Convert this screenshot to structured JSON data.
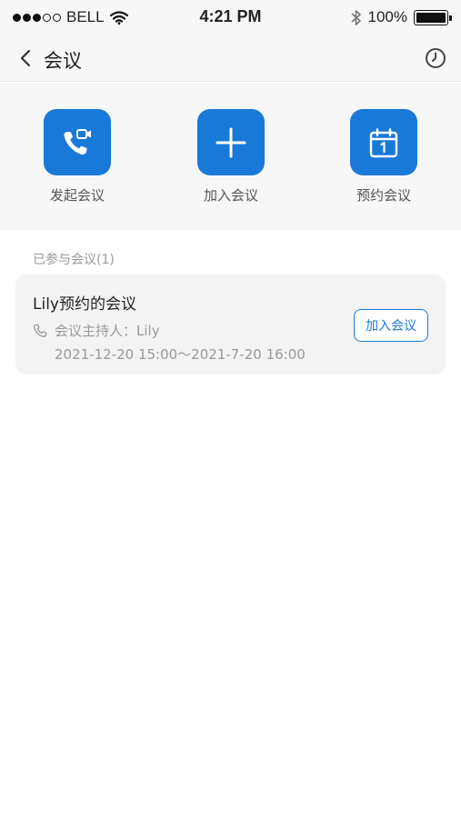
{
  "status_bar": {
    "carrier": "BELL",
    "time": "4:21 PM",
    "battery": "100%",
    "battery_level": 1.0,
    "signal_bars_filled": 3,
    "signal_bars_total": 5
  },
  "nav": {
    "title": "会议",
    "back_icon": "chevron-left-icon",
    "history_icon": "clock-icon"
  },
  "actions": [
    {
      "label": "发起会议",
      "icon": "video-call-icon"
    },
    {
      "label": "加入会议",
      "icon": "plus-icon"
    },
    {
      "label": "预约会议",
      "icon": "calendar-icon"
    }
  ],
  "section": {
    "label": "已参与会议(1)"
  },
  "meetings": [
    {
      "title": "Lily预约的会议",
      "host_label": "会议主持人：Lily",
      "time_range": "2021-12-20 15:00～2021-7-20 16:00",
      "join_label": "加入会议",
      "icon": "phone-icon"
    }
  ],
  "colors": {
    "accent": "#1979d9",
    "background": "#ffffff",
    "header_background": "#f7f7f7",
    "card_background": "#f3f3f3"
  }
}
